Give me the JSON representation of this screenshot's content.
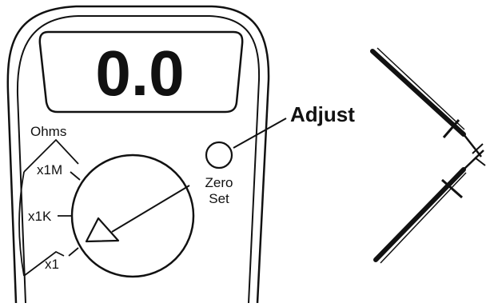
{
  "display": {
    "reading": "0.0"
  },
  "dial": {
    "title": "Ohms",
    "ranges": [
      {
        "label": "x1M"
      },
      {
        "label": "x1K"
      },
      {
        "label": "x1"
      }
    ]
  },
  "zero_set": {
    "line1": "Zero",
    "line2": "Set"
  },
  "callout": {
    "label": "Adjust"
  },
  "colors": {
    "ink": "#111111",
    "background": "#ffffff"
  }
}
